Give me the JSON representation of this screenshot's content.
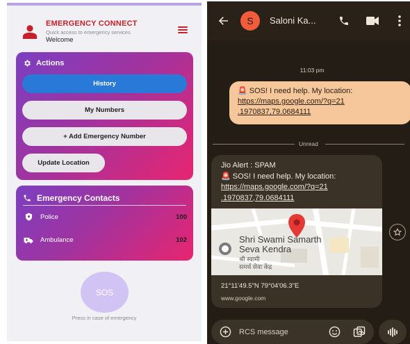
{
  "app": {
    "title": "EMERGENCY CONNECT",
    "subtitle": "Quick access to emergency services",
    "welcome": "Welcome",
    "accent_color": "#c6202a",
    "actions": {
      "heading": "Actions",
      "history": "History",
      "my_numbers": "My Numbers",
      "add_number": "+ Add Emergency Number",
      "update_location": "Update Location"
    },
    "contacts": {
      "heading": "Emergency Contacts",
      "items": [
        {
          "name": "Police",
          "number": "100",
          "icon": "shield-icon"
        },
        {
          "name": "Ambulance",
          "number": "102",
          "icon": "ambulance-icon"
        }
      ]
    },
    "sos": {
      "label": "SOS",
      "hint": "Press in case of emergency"
    }
  },
  "messages": {
    "contact_initial": "S",
    "contact_name": "Saloni Ka...",
    "timestamp": "11:03 pm",
    "outgoing": {
      "line1": "🚨 SOS! I need help. My location:",
      "link1": "https://maps.google.com/?q=21",
      "link2": ".1970837,79.0684111"
    },
    "unread_label": "Unread",
    "incoming": {
      "alert": "Jio Alert : SPAM",
      "line1": "🚨 SOS! I need help. My location:",
      "link1": "https://maps.google.com/?q=21",
      "link2": ".1970837,79.0684111",
      "map_place_en1": "Shri Swami Samarth",
      "map_place_en2": "Seva Kendra",
      "map_place_hi1": "श्री स्वामी",
      "map_place_hi2": "समर्थ सेवा केंद्र",
      "coords": "21°11'49.5\"N 79°04'06.3\"E",
      "domain": "www.google.com"
    },
    "input_placeholder": "RCS message"
  }
}
